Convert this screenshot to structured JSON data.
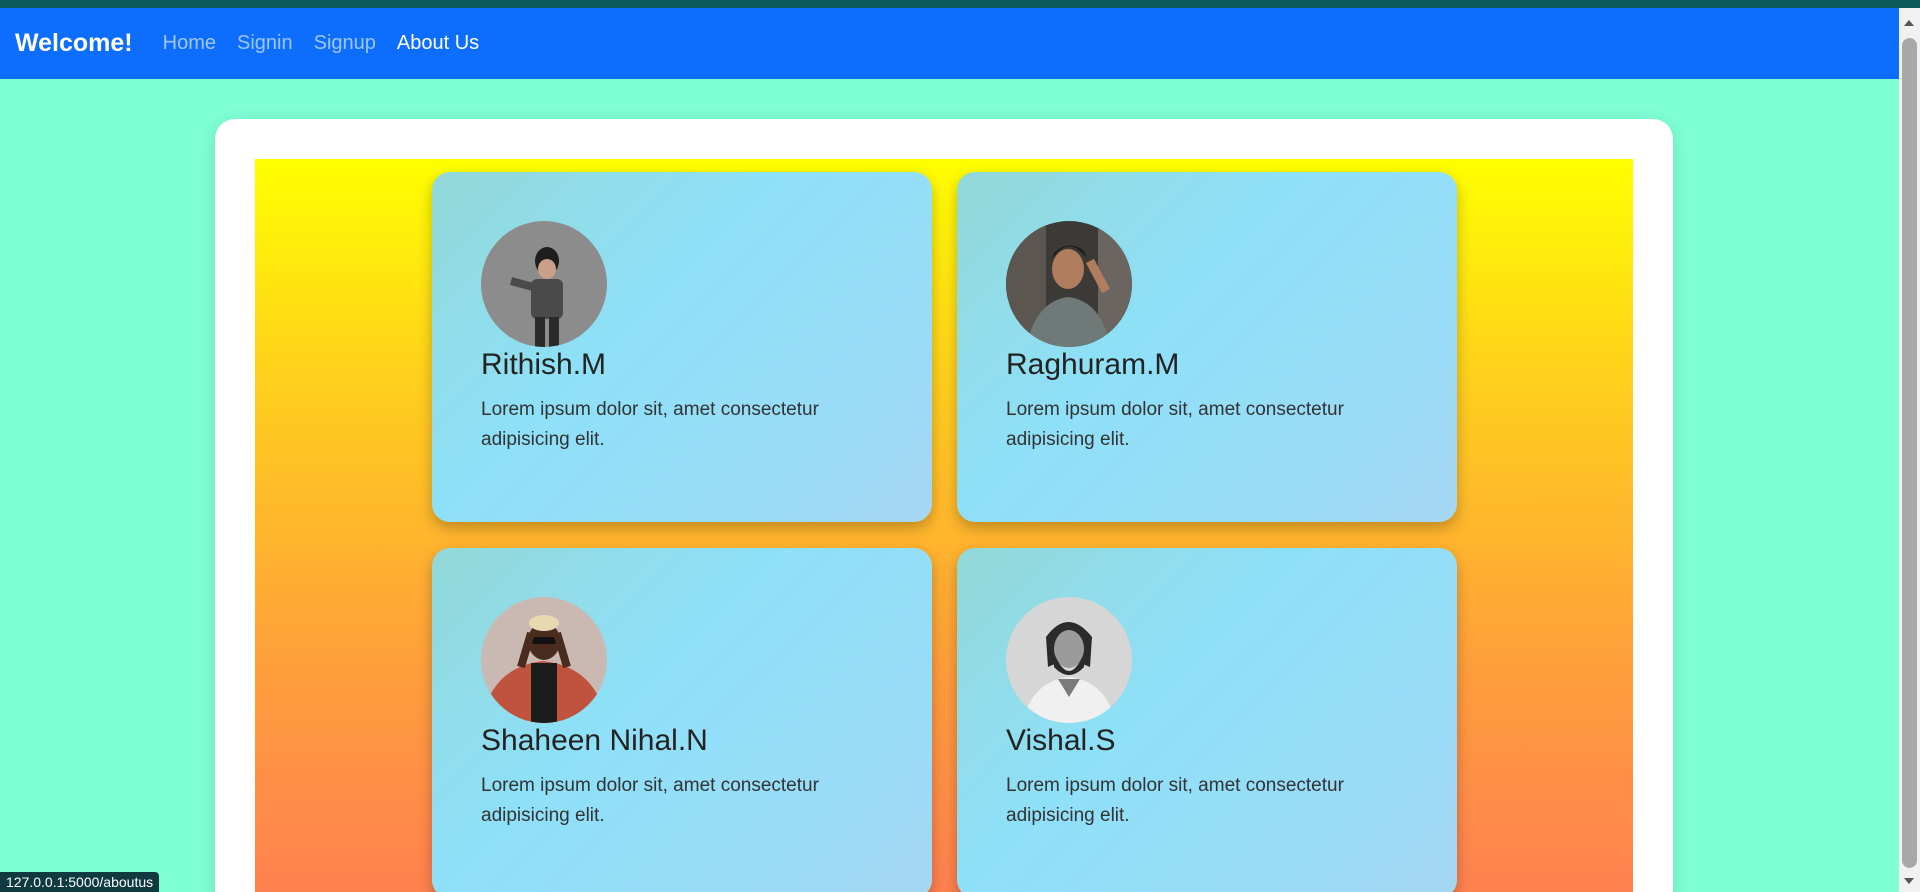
{
  "navbar": {
    "brand": "Welcome!",
    "links": [
      {
        "label": "Home"
      },
      {
        "label": "Signin"
      },
      {
        "label": "Signup"
      },
      {
        "label": "About Us",
        "active": true
      }
    ]
  },
  "team": [
    {
      "name": "Rithish.M",
      "description": "Lorem ipsum dolor sit, amet consectetur adipisicing elit."
    },
    {
      "name": "Raghuram.M",
      "description": "Lorem ipsum dolor sit, amet consectetur adipisicing elit."
    },
    {
      "name": "Shaheen Nihal.N",
      "description": "Lorem ipsum dolor sit, amet consectetur adipisicing elit."
    },
    {
      "name": "Vishal.S",
      "description": "Lorem ipsum dolor sit, amet consectetur adipisicing elit."
    }
  ],
  "status_bar": {
    "url": "127.0.0.1:5000/aboutus"
  },
  "colors": {
    "page_bg": "#7fffd4",
    "navbar_bg": "#0d6efd",
    "gradient_top": "#ffff00",
    "gradient_bottom": "#ff8050"
  }
}
